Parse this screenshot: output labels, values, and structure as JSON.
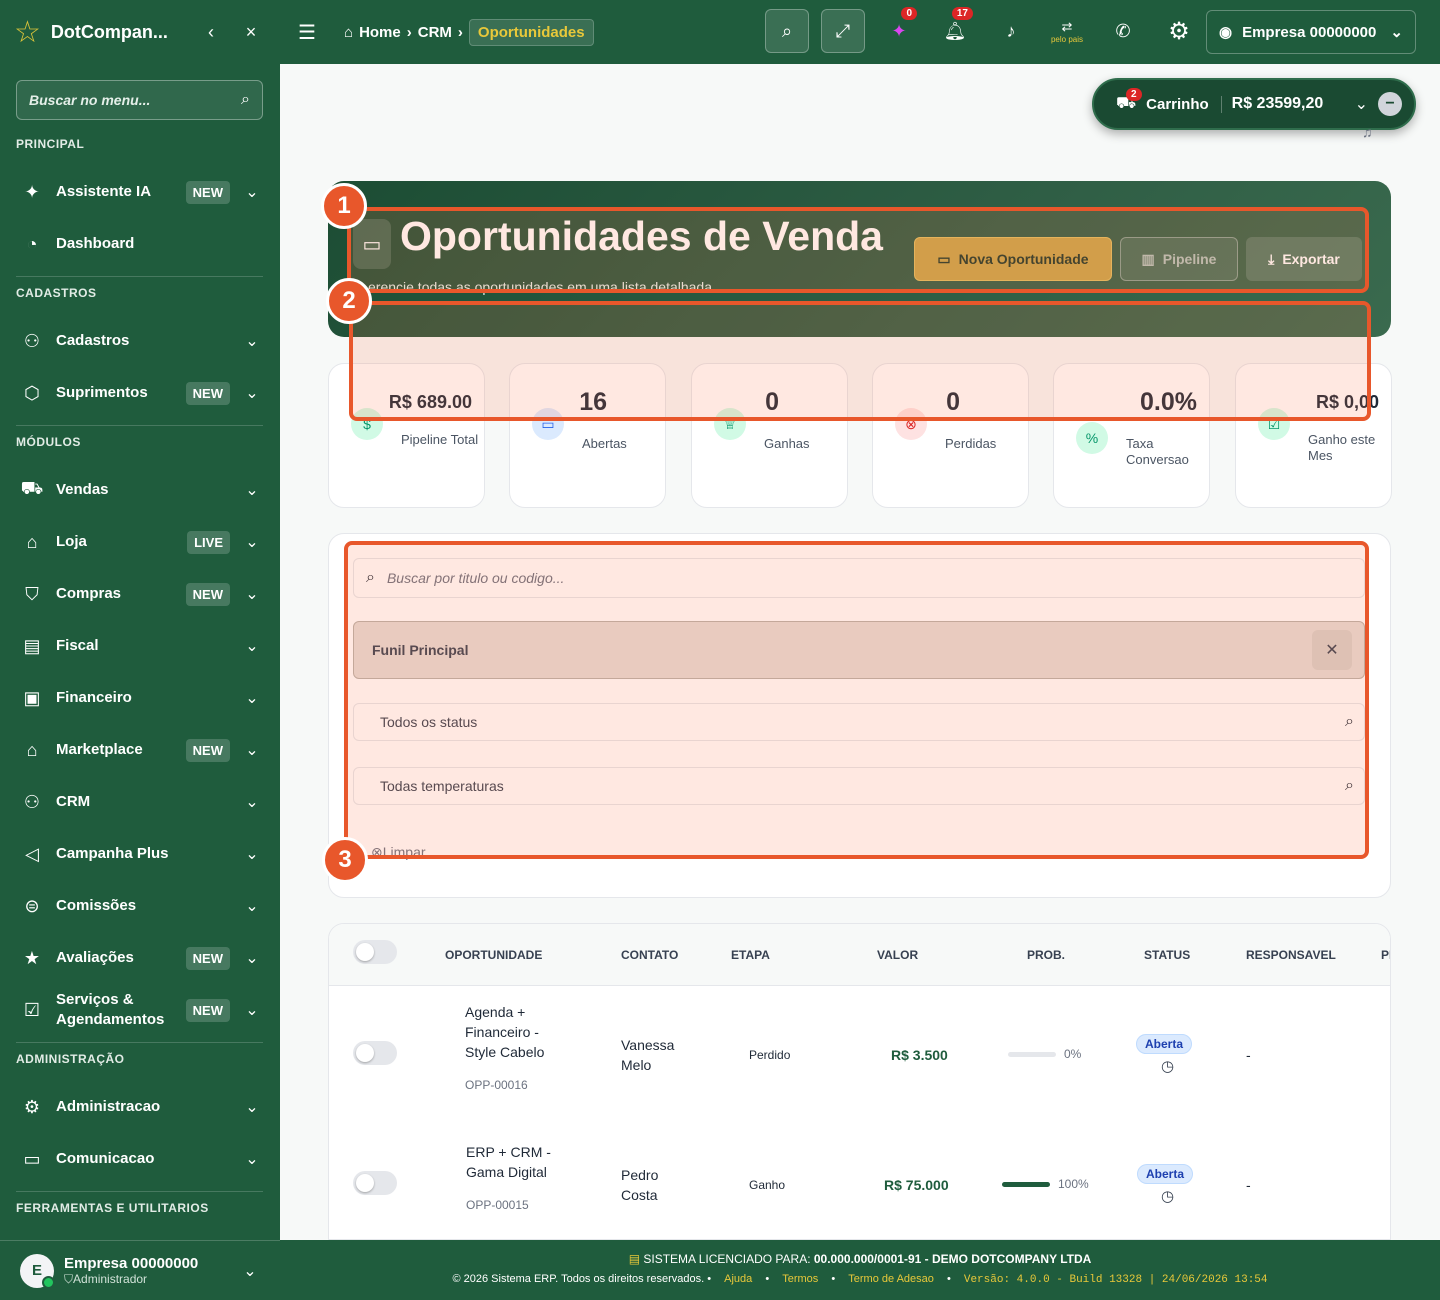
{
  "sidebar": {
    "brand": "DotCompan...",
    "search_placeholder": "Buscar no menu...",
    "sections": {
      "principal": "PRINCIPAL",
      "cadastros": "CADASTROS",
      "modulos": "MÓDULOS",
      "administracao": "ADMINISTRAÇÃO",
      "ferramentas": "FERRAMENTAS E UTILITARIOS"
    },
    "items": [
      {
        "label": "Assistente IA",
        "badge": "NEW",
        "icon": "sparkle-icon"
      },
      {
        "label": "Dashboard",
        "badge": "",
        "icon": "gauge-icon"
      },
      {
        "label": "Cadastros",
        "badge": "",
        "icon": "users-icon"
      },
      {
        "label": "Suprimentos",
        "badge": "NEW",
        "icon": "box-icon"
      },
      {
        "label": "Vendas",
        "badge": "",
        "icon": "cart-icon"
      },
      {
        "label": "Loja",
        "badge": "LIVE",
        "icon": "store-icon"
      },
      {
        "label": "Compras",
        "badge": "NEW",
        "icon": "basket-icon"
      },
      {
        "label": "Fiscal",
        "badge": "",
        "icon": "receipt-icon"
      },
      {
        "label": "Financeiro",
        "badge": "",
        "icon": "money-icon"
      },
      {
        "label": "Marketplace",
        "badge": "NEW",
        "icon": "shop-icon"
      },
      {
        "label": "CRM",
        "badge": "",
        "icon": "users-icon"
      },
      {
        "label": "Campanha Plus",
        "badge": "",
        "icon": "megaphone-icon"
      },
      {
        "label": "Comissões",
        "badge": "",
        "icon": "commission-icon"
      },
      {
        "label": "Avaliações",
        "badge": "NEW",
        "icon": "star-icon"
      },
      {
        "label": "Serviços & Agendamentos",
        "badge": "NEW",
        "icon": "calendar-icon"
      },
      {
        "label": "Administracao",
        "badge": "",
        "icon": "gear-icon"
      },
      {
        "label": "Comunicacao",
        "badge": "",
        "icon": "chat-icon"
      }
    ],
    "footer": {
      "initial": "E",
      "name": "Empresa 00000000",
      "role": "Administrador"
    }
  },
  "topbar": {
    "breadcrumb": {
      "home": "Home",
      "crm": "CRM",
      "current": "Oportunidades"
    },
    "ai_count": "0",
    "notif_count": "17",
    "company": "Empresa 00000000",
    "small_label": "pelo pais"
  },
  "cart": {
    "count": "2",
    "label": "Carrinho",
    "value": "R$ 23599,20"
  },
  "hero": {
    "title": "Oportunidades de Venda",
    "subtitle": "erencie todas as oportunidades em uma lista detalhada",
    "btn_new": "Nova Oportunidade",
    "btn_pipeline": "Pipeline",
    "btn_export": "Exportar"
  },
  "stats": [
    {
      "value": "R$ 689.00",
      "label": "Pipeline Total",
      "icon": "dollar-icon",
      "color": "#d1fae5"
    },
    {
      "value": "16",
      "label": "Abertas",
      "icon": "folder-icon",
      "color": "#dbeafe"
    },
    {
      "value": "0",
      "label": "Ganhas",
      "icon": "trophy-icon",
      "color": "#d1fae5"
    },
    {
      "value": "0",
      "label": "Perdidas",
      "icon": "x-circle-icon",
      "color": "#fee2e2"
    },
    {
      "value": "0.0%",
      "label": "Taxa Conversao",
      "icon": "percent-icon",
      "color": "#d1fae5"
    },
    {
      "value": "R$ 0,00",
      "label": "Ganho este Mes",
      "icon": "calendar-check-icon",
      "color": "#d1fae5"
    }
  ],
  "filters": {
    "search_placeholder": "Buscar por titulo ou codigo...",
    "funnel": "Funil Principal",
    "status": "Todos os status",
    "temperature": "Todas temperaturas",
    "clear": "Limpar"
  },
  "annotations": [
    "1",
    "2",
    "3"
  ],
  "table": {
    "headers": [
      "OPORTUNIDADE",
      "CONTATO",
      "ETAPA",
      "VALOR",
      "PROB.",
      "STATUS",
      "RESPONSAVEL",
      "PI"
    ],
    "rows": [
      {
        "title": "Agenda + Financeiro - Style Cabelo",
        "code": "OPP-00016",
        "contact": "Vanessa Melo",
        "stage": "Perdido",
        "value": "R$ 3.500",
        "prob": 0,
        "prob_label": "0%",
        "status": "Aberta",
        "resp": "-"
      },
      {
        "title": "ERP + CRM - Gama Digital",
        "code": "OPP-00015",
        "contact": "Pedro Costa",
        "stage": "Ganho",
        "value": "R$ 75.000",
        "prob": 100,
        "prob_label": "100%",
        "status": "Aberta",
        "resp": "-"
      }
    ]
  },
  "footer": {
    "license_prefix": "SISTEMA LICENCIADO PARA:",
    "license_value": "00.000.000/0001-91 - DEMO DOTCOMPANY LTDA",
    "copyright": "© 2026 Sistema ERP. Todos os direitos reservados.",
    "links": [
      "Ajuda",
      "Termos",
      "Termo de Adesao"
    ],
    "version": "Versão: 4.0.0 - Build 13328 | 24/06/2026 13:54"
  }
}
